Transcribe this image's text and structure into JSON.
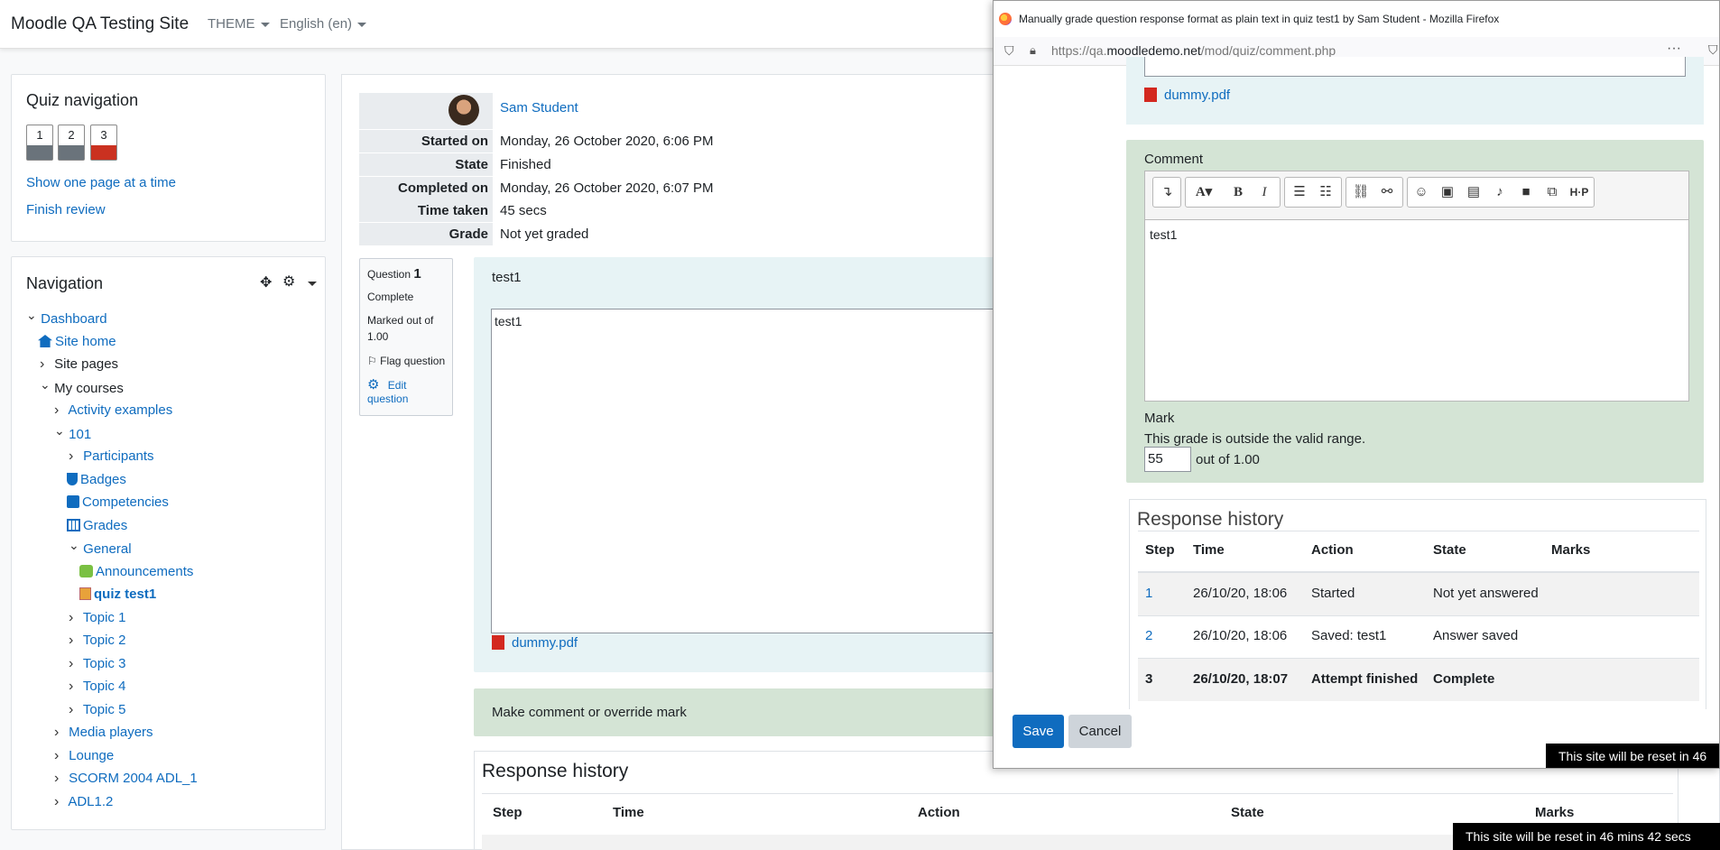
{
  "navbar": {
    "site_name": "Moodle QA Testing Site",
    "theme": "THEME",
    "language": "English (en)"
  },
  "quiz_nav": {
    "title": "Quiz navigation",
    "buttons": [
      {
        "label": "1"
      },
      {
        "label": "2"
      },
      {
        "label": "3"
      }
    ],
    "show_one_page": "Show one page at a time",
    "finish_review": "Finish review"
  },
  "navigation": {
    "title": "Navigation",
    "items": [
      {
        "label": "Dashboard"
      },
      {
        "label": "Site home"
      },
      {
        "label": "Site pages"
      },
      {
        "label": "My courses"
      },
      {
        "label": "Activity examples"
      },
      {
        "label": "101"
      },
      {
        "label": "Participants"
      },
      {
        "label": "Badges"
      },
      {
        "label": "Competencies"
      },
      {
        "label": "Grades"
      },
      {
        "label": "General"
      },
      {
        "label": "Announcements"
      },
      {
        "label": "quiz test1"
      },
      {
        "label": "Topic 1"
      },
      {
        "label": "Topic 2"
      },
      {
        "label": "Topic 3"
      },
      {
        "label": "Topic 4"
      },
      {
        "label": "Topic 5"
      },
      {
        "label": "Media players"
      },
      {
        "label": "Lounge"
      },
      {
        "label": "SCORM 2004 ADL_1"
      },
      {
        "label": "ADL1.2"
      }
    ]
  },
  "summary": {
    "user": "Sam Student",
    "rows": [
      {
        "label": "Started on",
        "value": "Monday, 26 October 2020, 6:06 PM"
      },
      {
        "label": "State",
        "value": "Finished"
      },
      {
        "label": "Completed on",
        "value": "Monday, 26 October 2020, 6:07 PM"
      },
      {
        "label": "Time taken",
        "value": "45 secs"
      },
      {
        "label": "Grade",
        "value": "Not yet graded"
      }
    ]
  },
  "question": {
    "label": "Question",
    "number": "1",
    "status": "Complete",
    "marked_out_of": "Marked out of",
    "max": "1.00",
    "flag": "Flag question",
    "edit": "Edit",
    "edit2": "question",
    "text": "test1",
    "answer": "test1",
    "attachment": "dummy.pdf",
    "comment_link": "Make comment or override mark"
  },
  "response_history": {
    "title": "Response history",
    "columns": [
      "Step",
      "Time",
      "Action",
      "State",
      "Marks"
    ],
    "rows": [
      {
        "step": "1",
        "time": "26/10/20, 18:06",
        "action": "Started",
        "state": "Not yet answered"
      },
      {
        "step": "2",
        "time": "26/10/20, 18:06",
        "action": "Saved: test1",
        "state": "Answer saved"
      },
      {
        "step": "3",
        "time": "26/10/20, 18:07",
        "action": "Attempt finished",
        "state": "Complete"
      }
    ]
  },
  "popup": {
    "window_title": "Manually grade question response format as plain text in quiz test1 by Sam Student - Mozilla Firefox",
    "url_prefix": "https://qa.",
    "url_domain": "moodledemo.net",
    "url_path": "/mod/quiz/comment.php",
    "attachment": "dummy.pdf",
    "comment_label": "Comment",
    "comment_text": "test1",
    "mark_label": "Mark",
    "mark_error": "This grade is outside the valid range.",
    "mark_value": "55",
    "out_of": "out of 1.00",
    "save": "Save",
    "cancel": "Cancel"
  },
  "reset_banner_popup": "This site will be reset in 46",
  "reset_banner": "This site will be reset in 46 mins 42 secs",
  "colors": {
    "link": "#0f6cbf",
    "incorrect": "#ca3120",
    "comment_bg": "#d4e4d5",
    "question_bg": "#e7f3f5"
  }
}
